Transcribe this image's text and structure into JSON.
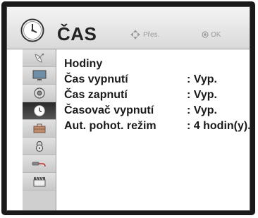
{
  "header": {
    "title": "ČAS",
    "nav_hint": "Přes.",
    "ok_hint": "OK",
    "icon": "clock-icon"
  },
  "sidebar": {
    "items": [
      {
        "icon": "satellite-dish-icon",
        "active": false
      },
      {
        "icon": "tv-screen-icon",
        "active": false
      },
      {
        "icon": "speaker-icon",
        "active": false
      },
      {
        "icon": "clock-icon",
        "active": true
      },
      {
        "icon": "briefcase-icon",
        "active": false
      },
      {
        "icon": "lock-icon",
        "active": false
      },
      {
        "icon": "input-cable-icon",
        "active": false
      },
      {
        "icon": "clapperboard-icon",
        "active": false
      }
    ]
  },
  "menu": {
    "items": [
      {
        "label": "Hodiny",
        "value": ""
      },
      {
        "label": "Čas vypnutí",
        "value": ": Vyp."
      },
      {
        "label": "Čas zapnutí",
        "value": ": Vyp."
      },
      {
        "label": "Časovač vypnutí",
        "value": ": Vyp."
      },
      {
        "label": "Aut. pohot. režim",
        "value": ": 4 hodin(y)."
      }
    ]
  },
  "colors": {
    "frame": "#1a1a1a",
    "highlight": "#333333",
    "hint": "#9a9a9a"
  }
}
